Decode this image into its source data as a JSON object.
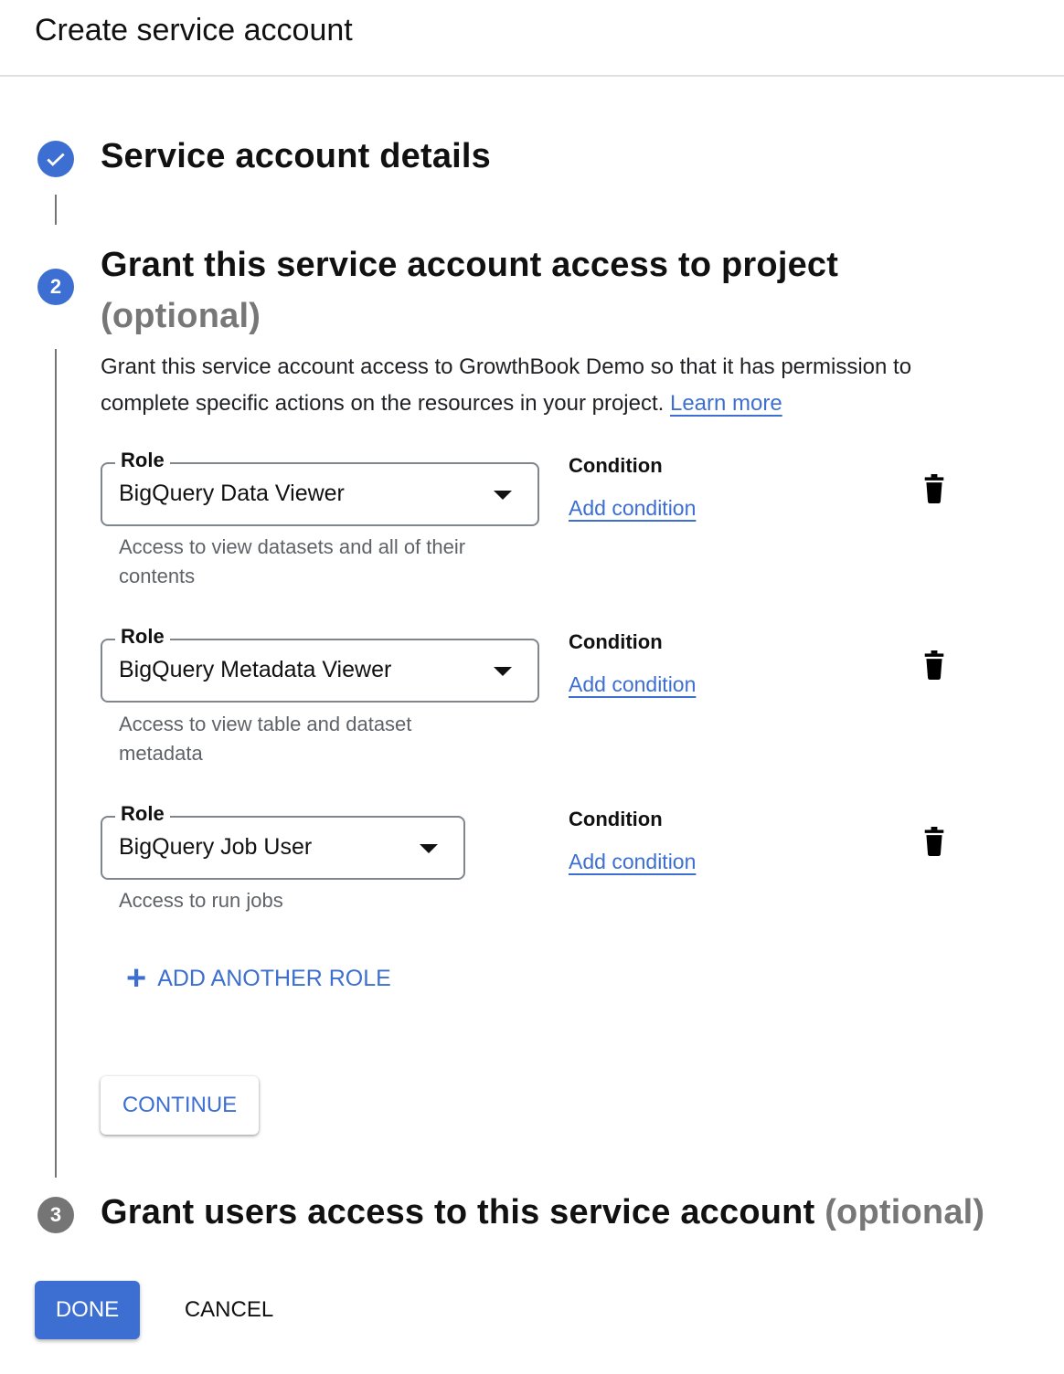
{
  "header": {
    "title": "Create service account"
  },
  "steps": [
    {
      "number": "✓",
      "icon": "check-circle-icon",
      "title": "Service account details",
      "optional": "",
      "state": "completed",
      "color": "#3c6fd1"
    },
    {
      "number": "2",
      "title": "Grant this service account access to project",
      "optional": "(optional)",
      "state": "active",
      "color": "#3c6fd1"
    },
    {
      "number": "3",
      "title": "Grant users access to this service account",
      "optional": "(optional)",
      "state": "inactive",
      "color": "#757575"
    }
  ],
  "step2": {
    "description": "Grant this service account access to GrowthBook Demo so that it has permission to complete specific actions on the resources in your project.",
    "learn_more": "Learn more",
    "roles": [
      {
        "label": "Role",
        "value": "BigQuery Data Viewer",
        "help": "Access to view datasets and all of their contents",
        "condition_label": "Condition",
        "condition_link": "Add condition"
      },
      {
        "label": "Role",
        "value": "BigQuery Metadata Viewer",
        "help": "Access to view table and dataset metadata",
        "condition_label": "Condition",
        "condition_link": "Add condition"
      },
      {
        "label": "Role",
        "value": "BigQuery Job User",
        "help": "Access to run jobs",
        "condition_label": "Condition",
        "condition_link": "Add condition"
      }
    ],
    "add_role": "ADD ANOTHER ROLE",
    "continue": "CONTINUE"
  },
  "footer": {
    "done": "DONE",
    "cancel": "CANCEL"
  },
  "colors": {
    "accent": "#3c6fd1",
    "inactive": "#757575"
  }
}
